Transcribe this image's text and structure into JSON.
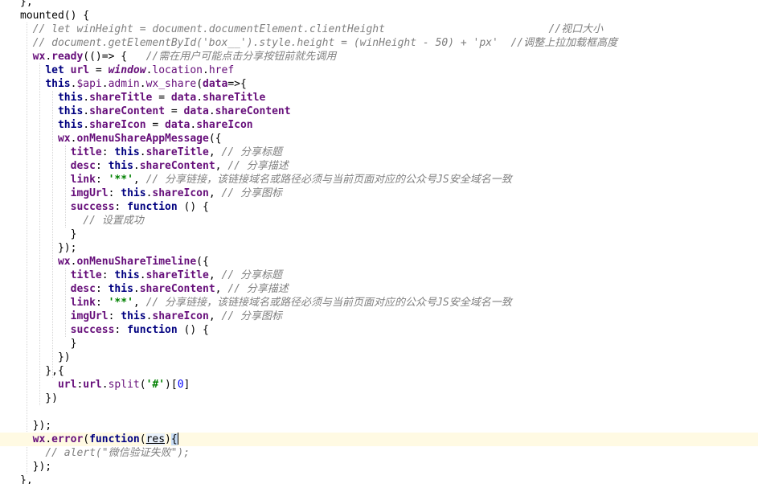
{
  "editor": {
    "lines": [
      {
        "text": "},"
      },
      {
        "text": "mounted() {"
      },
      {
        "text": "  // let winHeight = document.documentElement.clientHeight                          //视口大小"
      },
      {
        "text": "  // document.getElementById('box__').style.height = (winHeight - 50) + 'px'  //调整上拉加载框高度"
      },
      {
        "text": "  wx.ready(()=> {   //需在用户可能点击分享按钮前就先调用"
      },
      {
        "text": "    let url = window.location.href"
      },
      {
        "text": "    this.$api.admin.wx_share(data=>{"
      },
      {
        "text": "      this.shareTitle = data.shareTitle"
      },
      {
        "text": "      this.shareContent = data.shareContent"
      },
      {
        "text": "      this.shareIcon = data.shareIcon"
      },
      {
        "text": "      wx.onMenuShareAppMessage({"
      },
      {
        "text": "        title: this.shareTitle, // 分享标题"
      },
      {
        "text": "        desc: this.shareContent, // 分享描述"
      },
      {
        "text": "        link: '**', // 分享链接，该链接域名或路径必须与当前页面对应的公众号JS安全域名一致"
      },
      {
        "text": "        imgUrl: this.shareIcon, // 分享图标"
      },
      {
        "text": "        success: function () {"
      },
      {
        "text": "          // 设置成功"
      },
      {
        "text": "        }"
      },
      {
        "text": "      });"
      },
      {
        "text": "      wx.onMenuShareTimeline({"
      },
      {
        "text": "        title: this.shareTitle, // 分享标题"
      },
      {
        "text": "        desc: this.shareContent, // 分享描述"
      },
      {
        "text": "        link: '**', // 分享链接，该链接域名或路径必须与当前页面对应的公众号JS安全域名一致"
      },
      {
        "text": "        imgUrl: this.shareIcon, // 分享图标"
      },
      {
        "text": "        success: function () {"
      },
      {
        "text": "        }"
      },
      {
        "text": "      })"
      },
      {
        "text": "    },{"
      },
      {
        "text": "      url:url.split('#')[0]"
      },
      {
        "text": "    })"
      },
      {
        "text": ""
      },
      {
        "text": "  });"
      },
      {
        "text": "  wx.error(function(res){"
      },
      {
        "text": "    // alert(\"微信验证失败\");"
      },
      {
        "text": "  });"
      },
      {
        "text": "},"
      }
    ],
    "current_line": 32,
    "colors": {
      "keyword": "#000080",
      "property": "#660e7a",
      "comment": "#808080",
      "string": "#008000",
      "number": "#0000ff",
      "current_line_bg": "#fffae3",
      "brace_match_bg": "#c7dcf5"
    }
  }
}
